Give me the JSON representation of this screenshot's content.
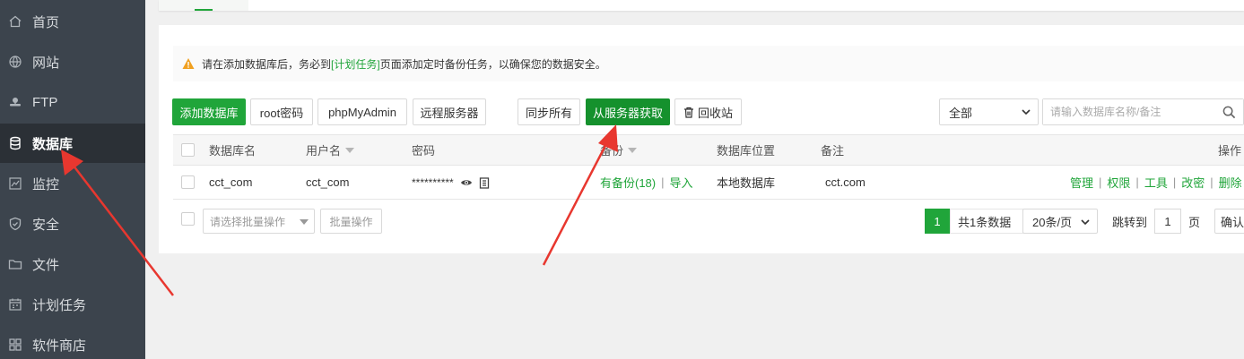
{
  "sidebar": {
    "items": [
      {
        "label": "首页",
        "icon": "home-icon"
      },
      {
        "label": "网站",
        "icon": "globe-icon"
      },
      {
        "label": "FTP",
        "icon": "ftp-icon"
      },
      {
        "label": "数据库",
        "icon": "database-icon",
        "active": true
      },
      {
        "label": "监控",
        "icon": "monitor-icon"
      },
      {
        "label": "安全",
        "icon": "shield-icon"
      },
      {
        "label": "文件",
        "icon": "folder-icon"
      },
      {
        "label": "计划任务",
        "icon": "calendar-icon"
      },
      {
        "label": "软件商店",
        "icon": "apps-icon"
      }
    ]
  },
  "notice": {
    "before": "请在添加数据库后，务必到",
    "link": "[计划任务]",
    "after": "页面添加定时备份任务，以确保您的数据安全。"
  },
  "toolbar": {
    "add_db": "添加数据库",
    "root_password": "root密码",
    "phpmyadmin": "phpMyAdmin",
    "remote_server": "远程服务器",
    "sync_all": "同步所有",
    "fetch_from_server": "从服务器获取",
    "recycle_bin": "回收站",
    "filter_select": "全部",
    "search_placeholder": "请输入数据库名称/备注"
  },
  "table": {
    "headers": {
      "name": "数据库名",
      "username": "用户名",
      "password": "密码",
      "backup": "备份",
      "location": "数据库位置",
      "note": "备注",
      "actions": "操作"
    },
    "rows": [
      {
        "name": "cct_com",
        "username": "cct_com",
        "password": "**********",
        "backup": "有备份(18)",
        "import": "导入",
        "location": "本地数据库",
        "note": "cct.com",
        "actions": [
          "管理",
          "权限",
          "工具",
          "改密",
          "删除"
        ]
      }
    ]
  },
  "footer": {
    "batch_placeholder": "请选择批量操作",
    "batch_button": "批量操作",
    "current_page": "1",
    "total_text": "共1条数据",
    "page_size": "20条/页",
    "jump_label": "跳转到",
    "jump_value": "1",
    "page_unit": "页",
    "confirm": "确认"
  },
  "colors": {
    "sidebar_bg": "#3c444d",
    "sidebar_active_bg": "#2b3036",
    "accent_green": "#20a53a",
    "arrow_red": "#e8372f",
    "warning_orange": "#f0a020"
  }
}
